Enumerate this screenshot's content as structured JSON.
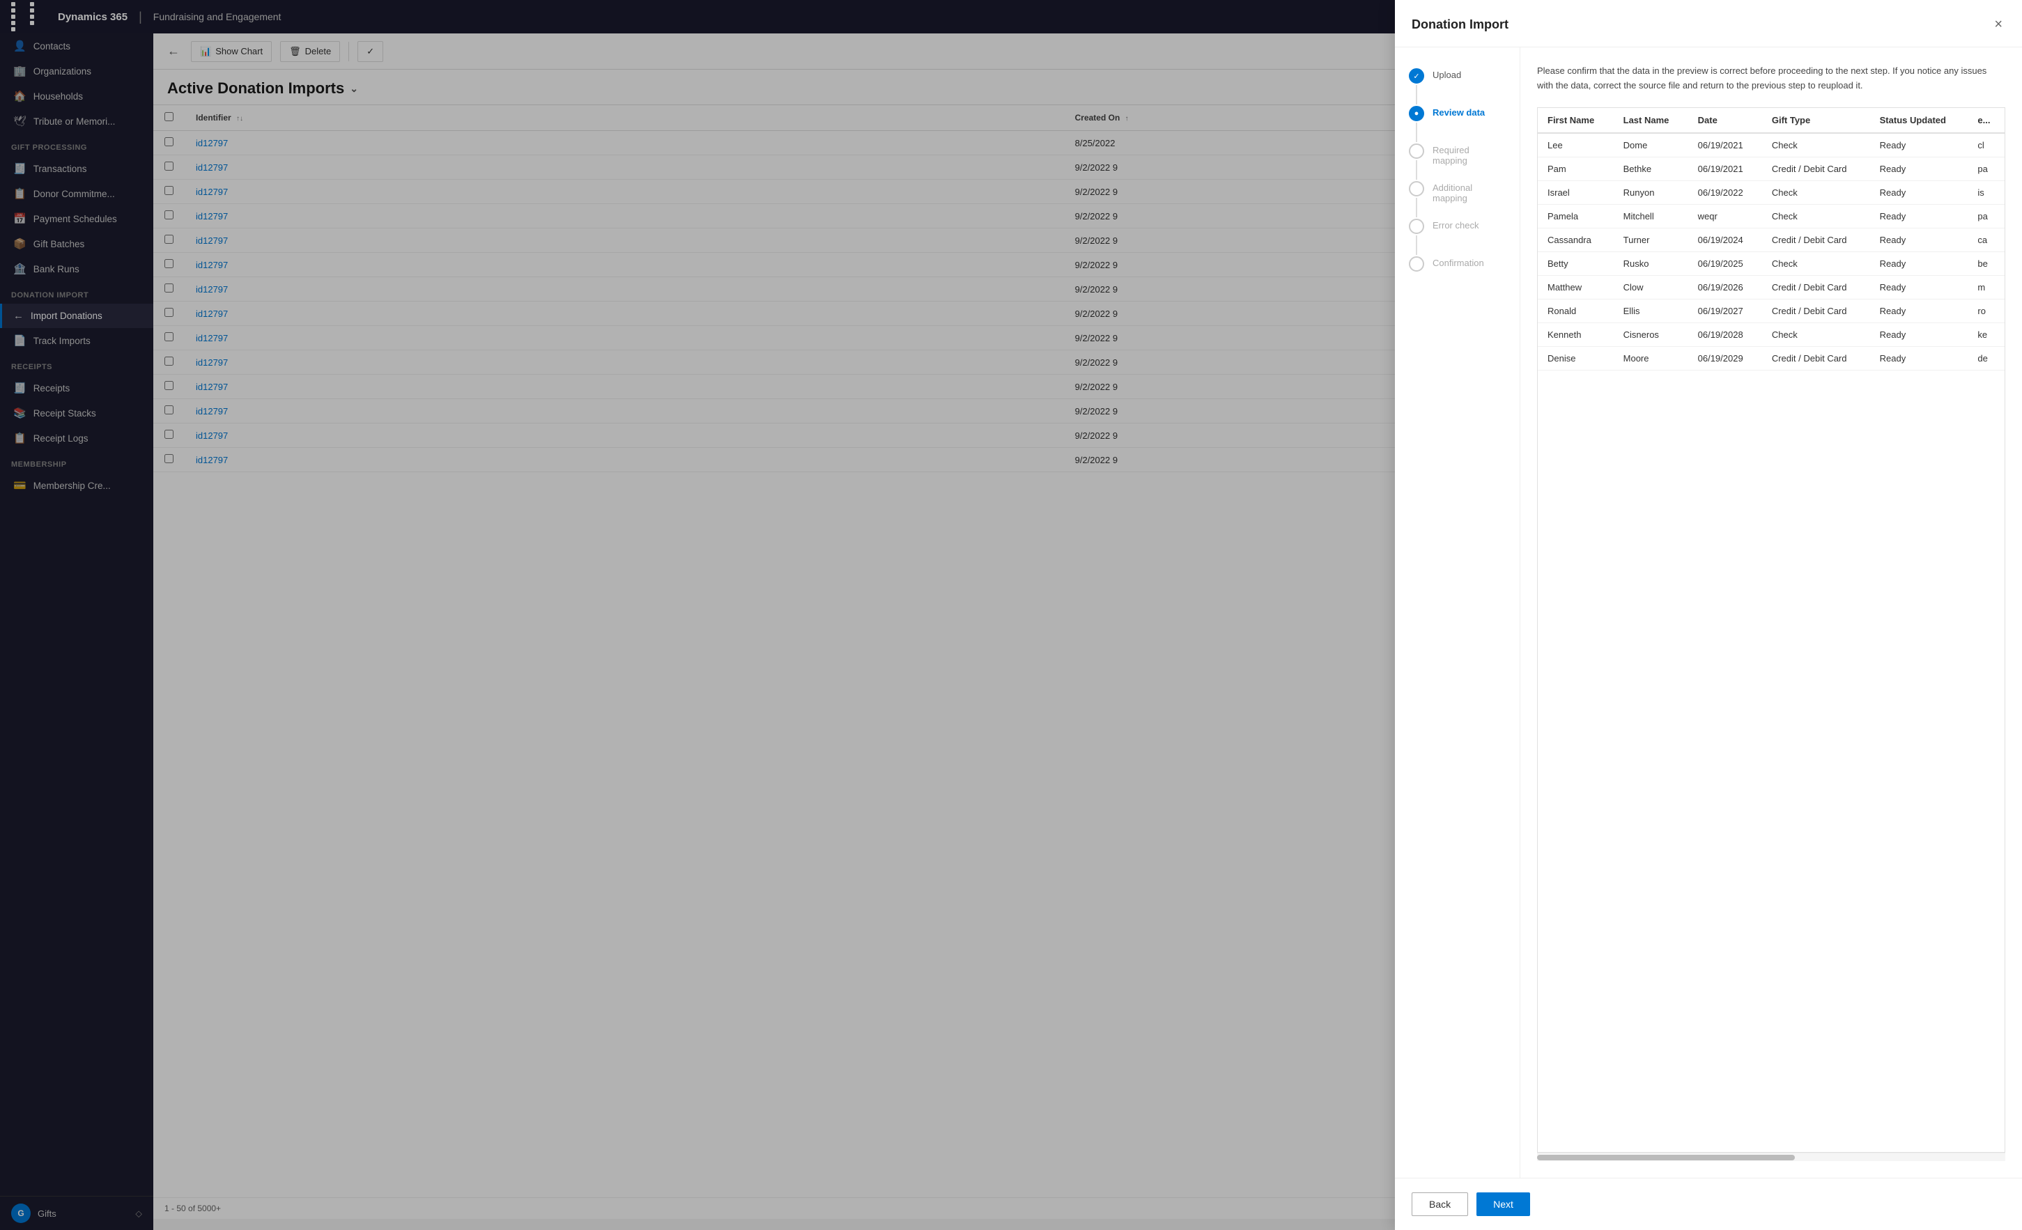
{
  "topNav": {
    "appName": "Dynamics 365",
    "subtitle": "Fundraising and Engagement"
  },
  "sidebar": {
    "sections": [
      {
        "header": "",
        "items": [
          {
            "id": "contacts",
            "label": "Contacts",
            "icon": "👤"
          },
          {
            "id": "organizations",
            "label": "Organizations",
            "icon": "🏢"
          },
          {
            "id": "households",
            "label": "Households",
            "icon": "🏠"
          },
          {
            "id": "tribute",
            "label": "Tribute or Memori...",
            "icon": "🕊"
          }
        ]
      },
      {
        "header": "Gift Processing",
        "items": [
          {
            "id": "transactions",
            "label": "Transactions",
            "icon": "🧾"
          },
          {
            "id": "donor-commitments",
            "label": "Donor Commitme...",
            "icon": "📋"
          },
          {
            "id": "payment-schedules",
            "label": "Payment Schedules",
            "icon": "📅"
          },
          {
            "id": "gift-batches",
            "label": "Gift Batches",
            "icon": "📦"
          },
          {
            "id": "bank-runs",
            "label": "Bank Runs",
            "icon": "🏦"
          }
        ]
      },
      {
        "header": "Donation Import",
        "items": [
          {
            "id": "import-donations",
            "label": "Import Donations",
            "icon": "⬅",
            "active": true
          },
          {
            "id": "track-imports",
            "label": "Track Imports",
            "icon": "📄"
          }
        ]
      },
      {
        "header": "Receipts",
        "items": [
          {
            "id": "receipts",
            "label": "Receipts",
            "icon": "🧾"
          },
          {
            "id": "receipt-stacks",
            "label": "Receipt Stacks",
            "icon": "📚"
          },
          {
            "id": "receipt-logs",
            "label": "Receipt Logs",
            "icon": "📋"
          }
        ]
      },
      {
        "header": "Membership",
        "items": [
          {
            "id": "membership-cre",
            "label": "Membership Cre...",
            "icon": "💳"
          }
        ]
      }
    ],
    "bottomLabel": "Gifts",
    "bottomAvatar": "G"
  },
  "toolbar": {
    "showChartLabel": "Show Chart",
    "deleteLabel": "Delete"
  },
  "pageTitle": "Active Donation Imports",
  "tableColumns": [
    "Identifier",
    "Created On"
  ],
  "tableRows": [
    {
      "id": "id12797",
      "createdOn": "8/25/2022"
    },
    {
      "id": "id12797",
      "createdOn": "9/2/2022 9"
    },
    {
      "id": "id12797",
      "createdOn": "9/2/2022 9"
    },
    {
      "id": "id12797",
      "createdOn": "9/2/2022 9"
    },
    {
      "id": "id12797",
      "createdOn": "9/2/2022 9"
    },
    {
      "id": "id12797",
      "createdOn": "9/2/2022 9"
    },
    {
      "id": "id12797",
      "createdOn": "9/2/2022 9"
    },
    {
      "id": "id12797",
      "createdOn": "9/2/2022 9"
    },
    {
      "id": "id12797",
      "createdOn": "9/2/2022 9"
    },
    {
      "id": "id12797",
      "createdOn": "9/2/2022 9"
    },
    {
      "id": "id12797",
      "createdOn": "9/2/2022 9"
    },
    {
      "id": "id12797",
      "createdOn": "9/2/2022 9"
    },
    {
      "id": "id12797",
      "createdOn": "9/2/2022 9"
    },
    {
      "id": "id12797",
      "createdOn": "9/2/2022 9"
    }
  ],
  "tableFooter": "1 - 50 of 5000+",
  "modal": {
    "title": "Donation Import",
    "description": "Please confirm that the data in the preview is correct before proceeding to the next step. If you notice any issues with the data, correct the source file and return to the previous step to reupload it.",
    "steps": [
      {
        "id": "upload",
        "label": "Upload",
        "state": "completed"
      },
      {
        "id": "review-data",
        "label": "Review data",
        "state": "active"
      },
      {
        "id": "required-mapping",
        "label": "Required mapping",
        "state": "inactive"
      },
      {
        "id": "additional-mapping",
        "label": "Additional mapping",
        "state": "inactive"
      },
      {
        "id": "error-check",
        "label": "Error check",
        "state": "inactive"
      },
      {
        "id": "confirmation",
        "label": "Confirmation",
        "state": "inactive"
      }
    ],
    "dataColumns": [
      "First Name",
      "Last Name",
      "Date",
      "Gift Type",
      "Status Updated",
      "e..."
    ],
    "dataRows": [
      {
        "firstName": "Lee",
        "lastName": "Dome",
        "date": "06/19/2021",
        "giftType": "Check",
        "statusUpdated": "Ready",
        "extra": "cl"
      },
      {
        "firstName": "Pam",
        "lastName": "Bethke",
        "date": "06/19/2021",
        "giftType": "Credit / Debit Card",
        "statusUpdated": "Ready",
        "extra": "pa"
      },
      {
        "firstName": "Israel",
        "lastName": "Runyon",
        "date": "06/19/2022",
        "giftType": "Check",
        "statusUpdated": "Ready",
        "extra": "is"
      },
      {
        "firstName": "Pamela",
        "lastName": "Mitchell",
        "date": "weqr",
        "giftType": "Check",
        "statusUpdated": "Ready",
        "extra": "pa"
      },
      {
        "firstName": "Cassandra",
        "lastName": "Turner",
        "date": "06/19/2024",
        "giftType": "Credit / Debit Card",
        "statusUpdated": "Ready",
        "extra": "ca"
      },
      {
        "firstName": "Betty",
        "lastName": "Rusko",
        "date": "06/19/2025",
        "giftType": "Check",
        "statusUpdated": "Ready",
        "extra": "be"
      },
      {
        "firstName": "Matthew",
        "lastName": "Clow",
        "date": "06/19/2026",
        "giftType": "Credit / Debit Card",
        "statusUpdated": "Ready",
        "extra": "m"
      },
      {
        "firstName": "Ronald",
        "lastName": "Ellis",
        "date": "06/19/2027",
        "giftType": "Credit / Debit Card",
        "statusUpdated": "Ready",
        "extra": "ro"
      },
      {
        "firstName": "Kenneth",
        "lastName": "Cisneros",
        "date": "06/19/2028",
        "giftType": "Check",
        "statusUpdated": "Ready",
        "extra": "ke"
      },
      {
        "firstName": "Denise",
        "lastName": "Moore",
        "date": "06/19/2029",
        "giftType": "Credit / Debit Card",
        "statusUpdated": "Ready",
        "extra": "de"
      }
    ],
    "backLabel": "Back",
    "nextLabel": "Next"
  }
}
